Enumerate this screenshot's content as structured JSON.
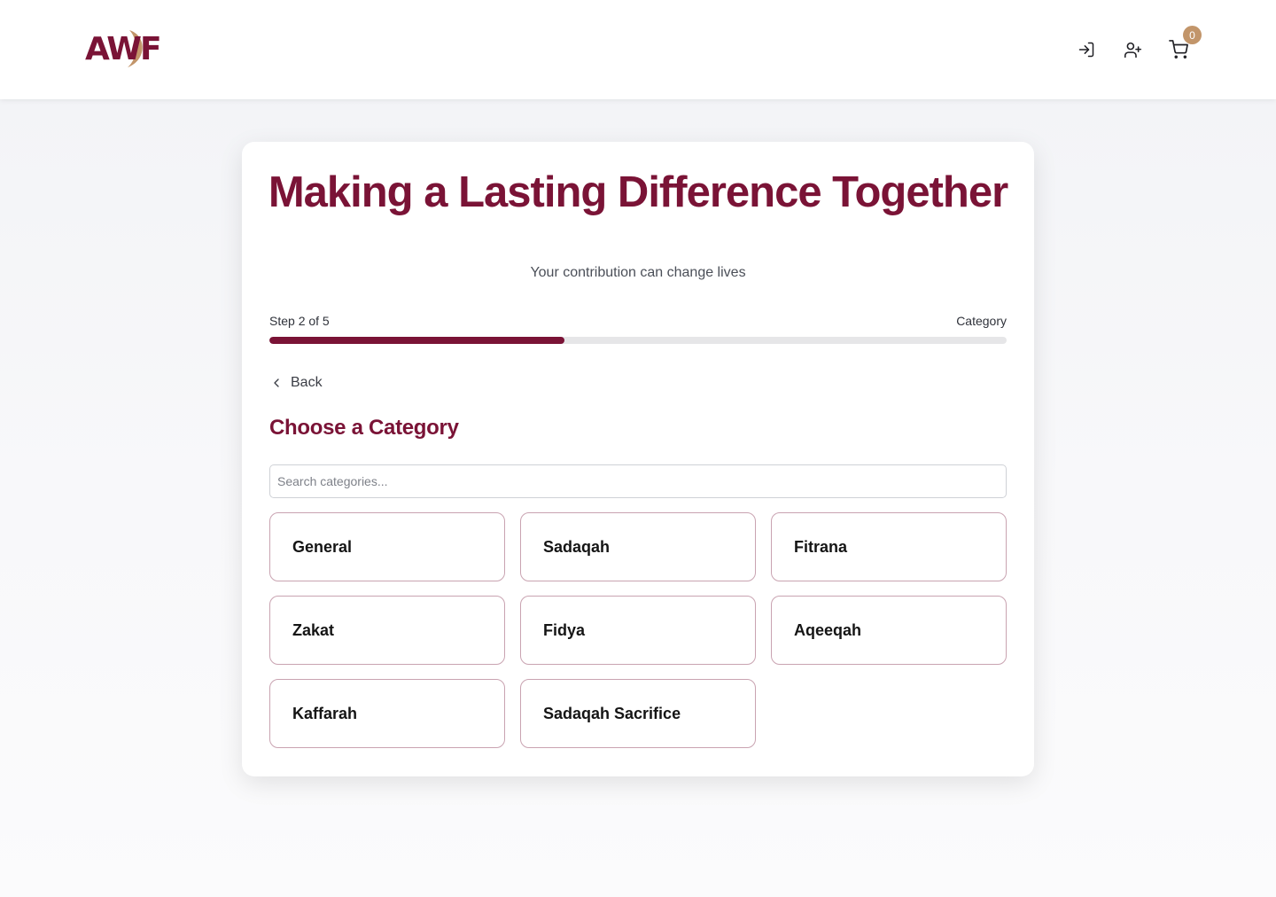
{
  "brand": {
    "logo_text": "AWF",
    "primary_color": "#7a1336",
    "accent_color": "#c2956a"
  },
  "nav": {
    "login_icon": "login-icon",
    "register_icon": "user-plus-icon",
    "cart_icon": "cart-icon",
    "cart_count": "0"
  },
  "hero": {
    "title": "Making a Lasting Difference Together",
    "subtitle": "Your contribution can change lives"
  },
  "progress": {
    "step_label": "Step 2 of 5",
    "step_name": "Category",
    "current_step": 2,
    "total_steps": 5,
    "fraction": 0.4
  },
  "back": {
    "label": "Back"
  },
  "section": {
    "title": "Choose a Category"
  },
  "search": {
    "placeholder": "Search categories..."
  },
  "categories": [
    {
      "label": "General"
    },
    {
      "label": "Sadaqah"
    },
    {
      "label": "Fitrana"
    },
    {
      "label": "Zakat"
    },
    {
      "label": "Fidya"
    },
    {
      "label": "Aqeeqah"
    },
    {
      "label": "Kaffarah"
    },
    {
      "label": "Sadaqah Sacrifice"
    }
  ]
}
